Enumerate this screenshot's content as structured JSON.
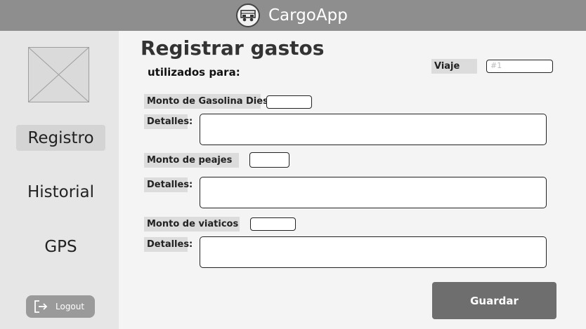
{
  "header": {
    "app_title": "CargoApp",
    "logo_icon": "truck-icon"
  },
  "sidebar": {
    "avatar_icon": "image-placeholder-icon",
    "items": [
      {
        "label": "Registro",
        "active": true
      },
      {
        "label": "Historial",
        "active": false
      },
      {
        "label": "GPS",
        "active": false
      }
    ],
    "logout": {
      "label": "Logout",
      "icon": "logout-icon"
    }
  },
  "main": {
    "title": "Registrar gastos",
    "subtitle": "utilizados para:",
    "trip": {
      "label": "Viaje",
      "placeholder": "#1"
    },
    "fields": [
      {
        "amount_label": "Monto de Gasolina Diesel",
        "details_label": "Detalles:"
      },
      {
        "amount_label": "Monto de peajes",
        "details_label": "Detalles:"
      },
      {
        "amount_label": "Monto de viaticos",
        "details_label": "Detalles:"
      }
    ],
    "save_label": "Guardar"
  }
}
